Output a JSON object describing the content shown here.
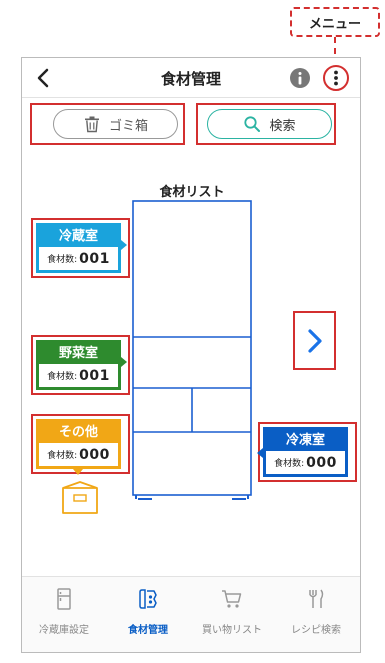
{
  "callout": {
    "label": "メニュー"
  },
  "header": {
    "title": "食材管理"
  },
  "actions": {
    "trash_label": "ゴミ箱",
    "search_label": "検索"
  },
  "fridge": {
    "list_title": "食材リスト"
  },
  "compartments": {
    "refrigerator": {
      "label": "冷蔵室",
      "count_label": "食材数:",
      "count": "001",
      "color": "#1aa3dc"
    },
    "vegetable": {
      "label": "野菜室",
      "count_label": "食材数:",
      "count": "001",
      "color": "#2e8b2e"
    },
    "other": {
      "label": "その他",
      "count_label": "食材数:",
      "count": "000",
      "color": "#f1a716"
    },
    "freezer": {
      "label": "冷凍室",
      "count_label": "食材数:",
      "count": "000",
      "color": "#0a5ec5"
    }
  },
  "bottom_nav": {
    "items": [
      {
        "label": "冷蔵庫設定",
        "icon": "fridge-icon",
        "active": false
      },
      {
        "label": "食材管理",
        "icon": "ingredients-icon",
        "active": true
      },
      {
        "label": "買い物リスト",
        "icon": "cart-icon",
        "active": false
      },
      {
        "label": "レシピ検索",
        "icon": "cutlery-icon",
        "active": false
      }
    ]
  },
  "colors": {
    "accent": "#0a5ec5",
    "highlight": "#d32f2f",
    "search_border": "#2bb3a2"
  }
}
